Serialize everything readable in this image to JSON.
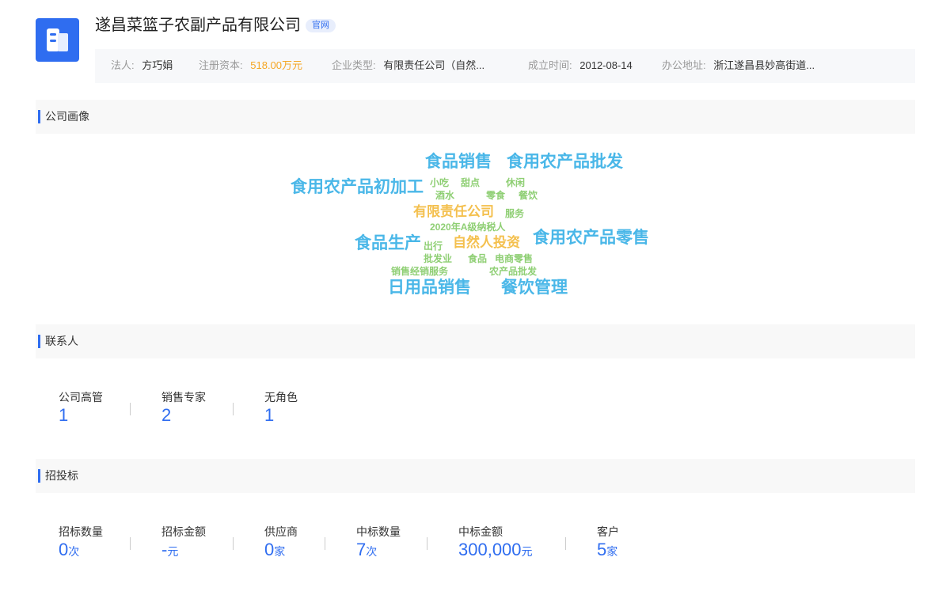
{
  "company": {
    "name": "遂昌菜篮子农副产品有限公司",
    "badge": "官网"
  },
  "info": {
    "legal_label": "法人:",
    "legal_value": "方巧娟",
    "capital_label": "注册资本:",
    "capital_value": "518.00万元",
    "type_label": "企业类型:",
    "type_value": "有限责任公司（自然...",
    "founded_label": "成立时间:",
    "founded_value": "2012-08-14",
    "address_label": "办公地址:",
    "address_value": "浙江遂昌县妙高街道..."
  },
  "sections": {
    "profile": "公司画像",
    "contacts": "联系人",
    "bidding": "招投标"
  },
  "word_cloud": [
    {
      "text": "食品销售",
      "color": "#4ab7e8"
    },
    {
      "text": "食用农产品批发",
      "color": "#4ab7e8"
    },
    {
      "text": "食用农产品初加工",
      "color": "#4ab7e8"
    },
    {
      "text": "小吃",
      "color": "#8fcf74"
    },
    {
      "text": "甜点",
      "color": "#8fcf74"
    },
    {
      "text": "休闲",
      "color": "#8fcf74"
    },
    {
      "text": "酒水",
      "color": "#8fcf74"
    },
    {
      "text": "零食",
      "color": "#8fcf74"
    },
    {
      "text": "餐饮",
      "color": "#8fcf74"
    },
    {
      "text": "有限责任公司",
      "color": "#f4c04e"
    },
    {
      "text": "服务",
      "color": "#8fcf74"
    },
    {
      "text": "2020年A级纳税人",
      "color": "#8fcf74"
    },
    {
      "text": "食品生产",
      "color": "#4ab7e8"
    },
    {
      "text": "出行",
      "color": "#8fcf74"
    },
    {
      "text": "自然人投资",
      "color": "#f4c04e"
    },
    {
      "text": "食用农产品零售",
      "color": "#4ab7e8"
    },
    {
      "text": "批发业",
      "color": "#8fcf74"
    },
    {
      "text": "食品",
      "color": "#8fcf74"
    },
    {
      "text": "电商零售",
      "color": "#8fcf74"
    },
    {
      "text": "销售经销服务",
      "color": "#8fcf74"
    },
    {
      "text": "农产品批发",
      "color": "#8fcf74"
    },
    {
      "text": "日用品销售",
      "color": "#4ab7e8"
    },
    {
      "text": "餐饮管理",
      "color": "#4ab7e8"
    }
  ],
  "contacts": [
    {
      "label": "公司高管",
      "value": "1"
    },
    {
      "label": "销售专家",
      "value": "2"
    },
    {
      "label": "无角色",
      "value": "1"
    }
  ],
  "bidding": [
    {
      "label": "招标数量",
      "value": "0",
      "unit": "次"
    },
    {
      "label": "招标金额",
      "value": "-",
      "unit": "元"
    },
    {
      "label": "供应商",
      "value": "0",
      "unit": "家"
    },
    {
      "label": "中标数量",
      "value": "7",
      "unit": "次"
    },
    {
      "label": "中标金额",
      "value": "300,000",
      "unit": "元"
    },
    {
      "label": "客户",
      "value": "5",
      "unit": "家"
    }
  ]
}
